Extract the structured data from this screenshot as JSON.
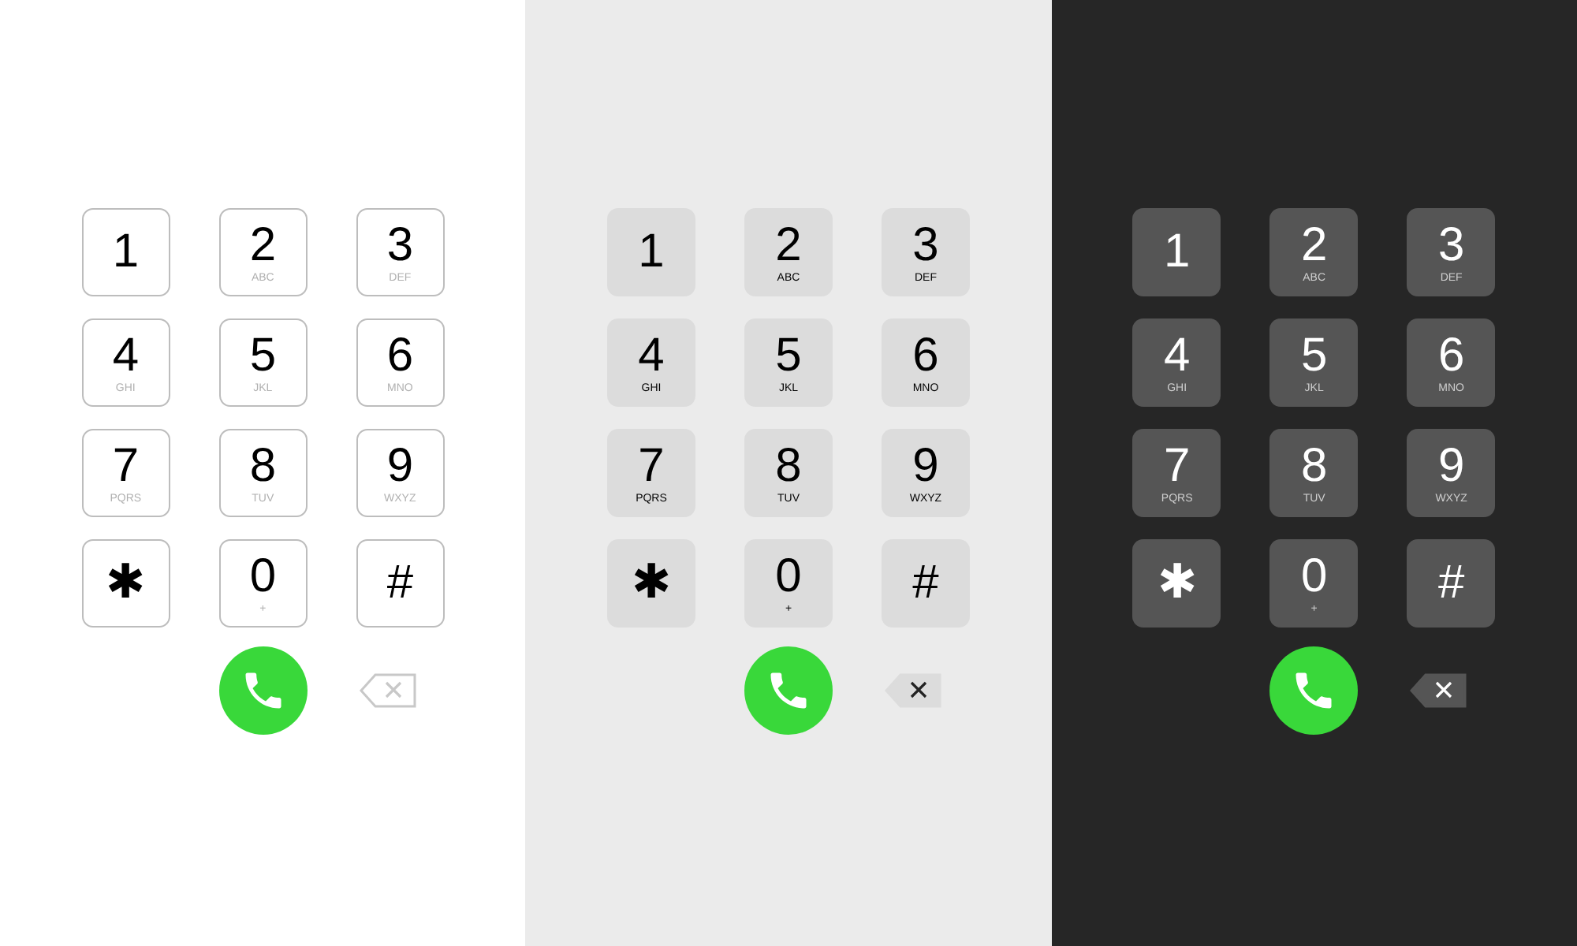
{
  "keypads": [
    {
      "kind": "light",
      "keys": [
        {
          "digit": "1"
        },
        {
          "digit": "2",
          "letters": "ABC"
        },
        {
          "digit": "3",
          "letters": "DEF"
        },
        {
          "digit": "4",
          "letters": "GHI"
        },
        {
          "digit": "5",
          "letters": "JKL"
        },
        {
          "digit": "6",
          "letters": "MNO"
        },
        {
          "digit": "7",
          "letters": "PQRS"
        },
        {
          "digit": "8",
          "letters": "TUV"
        },
        {
          "digit": "9",
          "letters": "WXYZ"
        },
        {
          "digit": "✱"
        },
        {
          "digit": "0",
          "letters": "+"
        },
        {
          "digit": "#"
        }
      ]
    },
    {
      "kind": "gray",
      "keys": [
        {
          "digit": "1"
        },
        {
          "digit": "2",
          "letters": "ABC"
        },
        {
          "digit": "3",
          "letters": "DEF"
        },
        {
          "digit": "4",
          "letters": "GHI"
        },
        {
          "digit": "5",
          "letters": "JKL"
        },
        {
          "digit": "6",
          "letters": "MNO"
        },
        {
          "digit": "7",
          "letters": "PQRS"
        },
        {
          "digit": "8",
          "letters": "TUV"
        },
        {
          "digit": "9",
          "letters": "WXYZ"
        },
        {
          "digit": "✱"
        },
        {
          "digit": "0",
          "letters": "+"
        },
        {
          "digit": "#"
        }
      ]
    },
    {
      "kind": "dark",
      "keys": [
        {
          "digit": "1"
        },
        {
          "digit": "2",
          "letters": "ABC"
        },
        {
          "digit": "3",
          "letters": "DEF"
        },
        {
          "digit": "4",
          "letters": "GHI"
        },
        {
          "digit": "5",
          "letters": "JKL"
        },
        {
          "digit": "6",
          "letters": "MNO"
        },
        {
          "digit": "7",
          "letters": "PQRS"
        },
        {
          "digit": "8",
          "letters": "TUV"
        },
        {
          "digit": "9",
          "letters": "WXYZ"
        },
        {
          "digit": "✱"
        },
        {
          "digit": "0",
          "letters": "+"
        },
        {
          "digit": "#"
        }
      ]
    }
  ]
}
